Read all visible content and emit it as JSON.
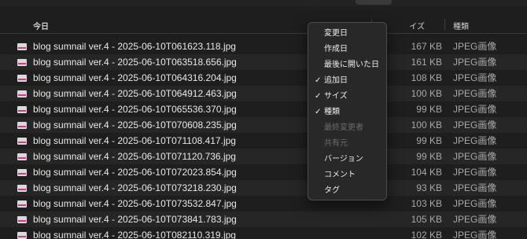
{
  "header": {
    "name": "今日",
    "size": "イズ",
    "kind": "種類"
  },
  "files": [
    {
      "name": "blog sumnail ver.4 - 2025-06-10T061623.118.jpg",
      "size": "167 KB",
      "kind": "JPEG画像"
    },
    {
      "name": "blog sumnail ver.4 - 2025-06-10T063518.656.jpg",
      "size": "161 KB",
      "kind": "JPEG画像"
    },
    {
      "name": "blog sumnail ver.4 - 2025-06-10T064316.204.jpg",
      "size": "108 KB",
      "kind": "JPEG画像"
    },
    {
      "name": "blog sumnail ver.4 - 2025-06-10T064912.463.jpg",
      "size": "100 KB",
      "kind": "JPEG画像"
    },
    {
      "name": "blog sumnail ver.4 - 2025-06-10T065536.370.jpg",
      "size": "99 KB",
      "kind": "JPEG画像"
    },
    {
      "name": "blog sumnail ver.4 - 2025-06-10T070608.235.jpg",
      "size": "100 KB",
      "kind": "JPEG画像"
    },
    {
      "name": "blog sumnail ver.4 - 2025-06-10T071108.417.jpg",
      "size": "99 KB",
      "kind": "JPEG画像"
    },
    {
      "name": "blog sumnail ver.4 - 2025-06-10T071120.736.jpg",
      "size": "99 KB",
      "kind": "JPEG画像"
    },
    {
      "name": "blog sumnail ver.4 - 2025-06-10T072023.854.jpg",
      "size": "104 KB",
      "kind": "JPEG画像"
    },
    {
      "name": "blog sumnail ver.4 - 2025-06-10T073218.230.jpg",
      "size": "93 KB",
      "kind": "JPEG画像"
    },
    {
      "name": "blog sumnail ver.4 - 2025-06-10T073532.847.jpg",
      "size": "103 KB",
      "kind": "JPEG画像"
    },
    {
      "name": "blog sumnail ver.4 - 2025-06-10T073841.783.jpg",
      "size": "105 KB",
      "kind": "JPEG画像"
    },
    {
      "name": "blog sumnail ver.4 - 2025-06-10T082110.319.jpg",
      "size": "102 KB",
      "kind": "JPEG画像"
    }
  ],
  "menu": {
    "items": [
      {
        "label": "変更日",
        "checked": false,
        "enabled": true
      },
      {
        "label": "作成日",
        "checked": false,
        "enabled": true
      },
      {
        "label": "最後に開いた日",
        "checked": false,
        "enabled": true
      },
      {
        "label": "追加日",
        "checked": true,
        "enabled": true
      },
      {
        "label": "サイズ",
        "checked": true,
        "enabled": true
      },
      {
        "label": "種類",
        "checked": true,
        "enabled": true
      },
      {
        "label": "最終変更者",
        "checked": false,
        "enabled": false
      },
      {
        "label": "共有元",
        "checked": false,
        "enabled": false
      },
      {
        "label": "バージョン",
        "checked": false,
        "enabled": true
      },
      {
        "label": "コメント",
        "checked": false,
        "enabled": true
      },
      {
        "label": "タグ",
        "checked": false,
        "enabled": true
      }
    ],
    "check_glyph": "✓"
  }
}
